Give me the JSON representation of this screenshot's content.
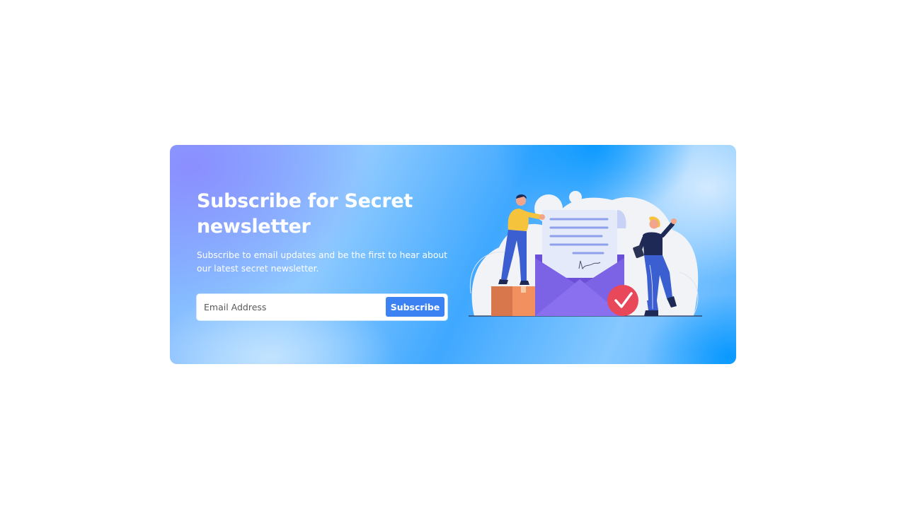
{
  "newsletter": {
    "title": "Subscribe for Secret newsletter",
    "description": "Subscribe to email updates and be the first to hear about our latest secret newsletter.",
    "email_placeholder": "Email Address",
    "email_value": "",
    "subscribe_label": "Subscribe",
    "illustration_icon": "newsletter-envelope-illustration"
  },
  "colors": {
    "card_gradient_start": "#8a8cff",
    "card_gradient_mid": "#3aa6ff",
    "button": "#3d82f2",
    "envelope": "#7b61e8",
    "check_badge": "#e9485a"
  }
}
